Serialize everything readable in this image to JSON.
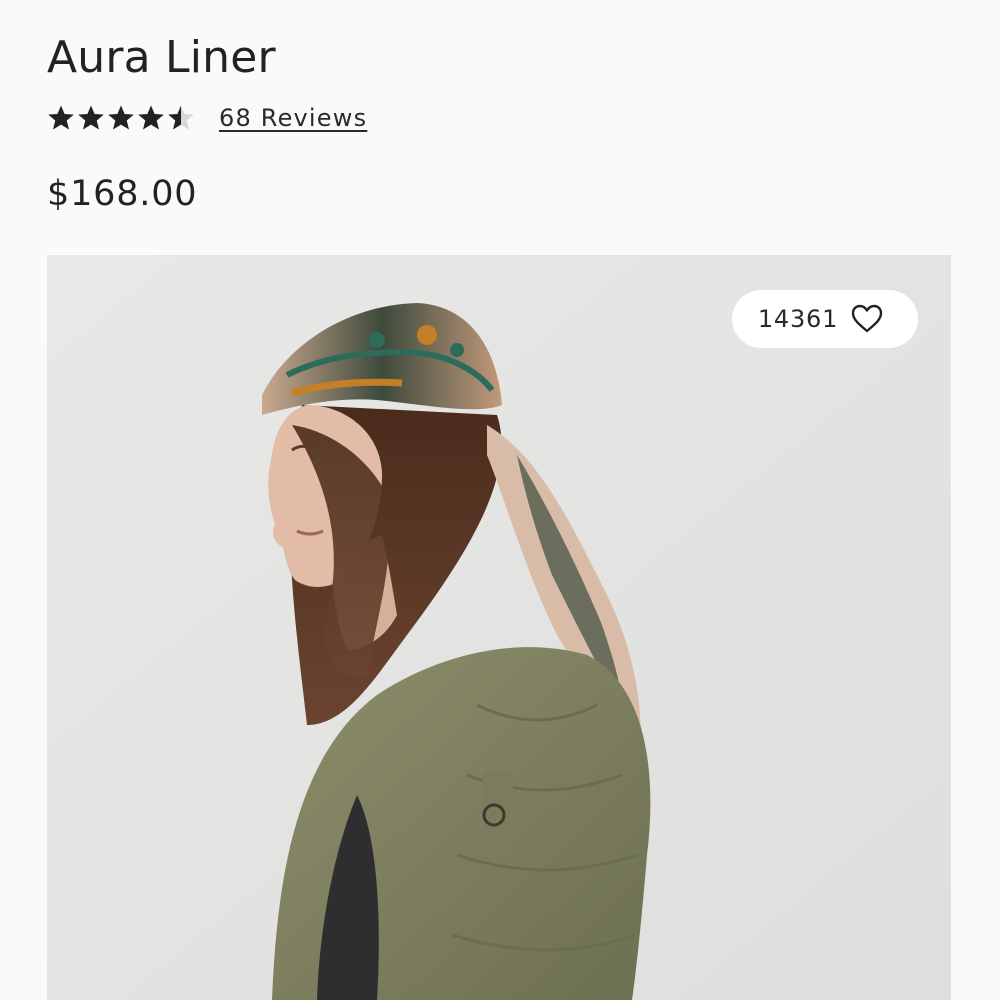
{
  "product": {
    "title": "Aura Liner",
    "price": "$168.00",
    "rating": 4.5,
    "rating_max": 5,
    "reviews_label": "68 Reviews"
  },
  "favorites": {
    "count": "14361",
    "icon": "heart-outline-icon"
  },
  "image": {
    "subject": "product-photo"
  },
  "colors": {
    "background": "#fcfaf9",
    "image_background": "#e6e6e5",
    "text": "#222222",
    "star": "#222222",
    "star_empty": "#d8d8d8"
  }
}
